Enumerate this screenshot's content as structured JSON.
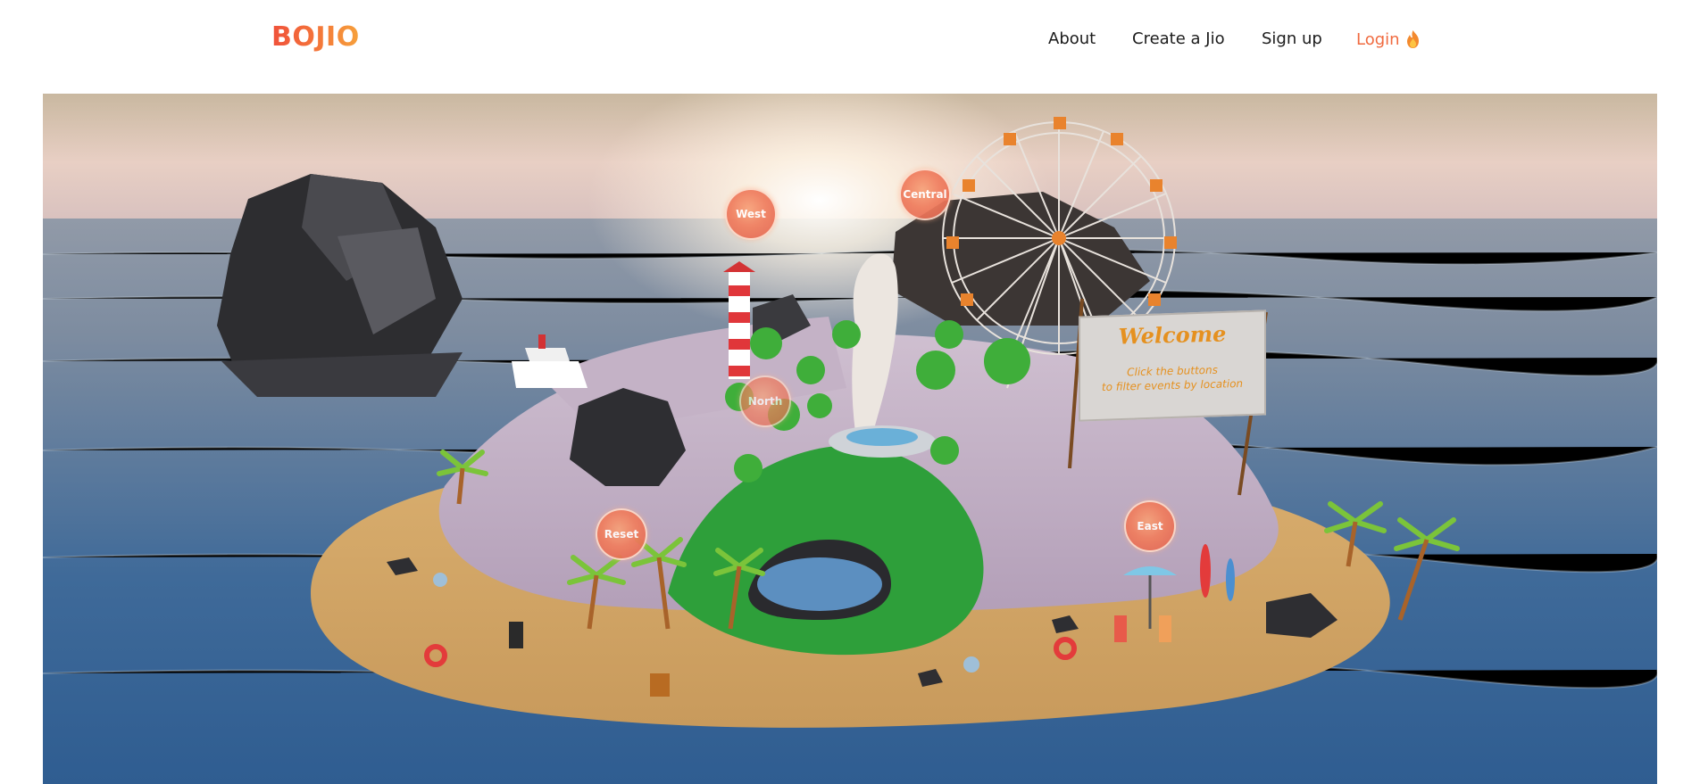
{
  "navbar": {
    "logo": "BOJIO",
    "links": {
      "about": "About",
      "create": "Create a Jio",
      "signup": "Sign up",
      "login": "Login"
    }
  },
  "scene": {
    "hotspots": {
      "west": "West",
      "central": "Central",
      "north": "North",
      "reset": "Reset",
      "east": "East"
    },
    "sign": {
      "title": "Welcome",
      "line1": "Click the buttons",
      "line2": "to filter events by location"
    }
  },
  "colors": {
    "brand_start": "#f0513a",
    "brand_end": "#f6a13b",
    "login": "#f06a3f",
    "hotspot": "#f07d5e",
    "sign_text": "#e59120"
  }
}
